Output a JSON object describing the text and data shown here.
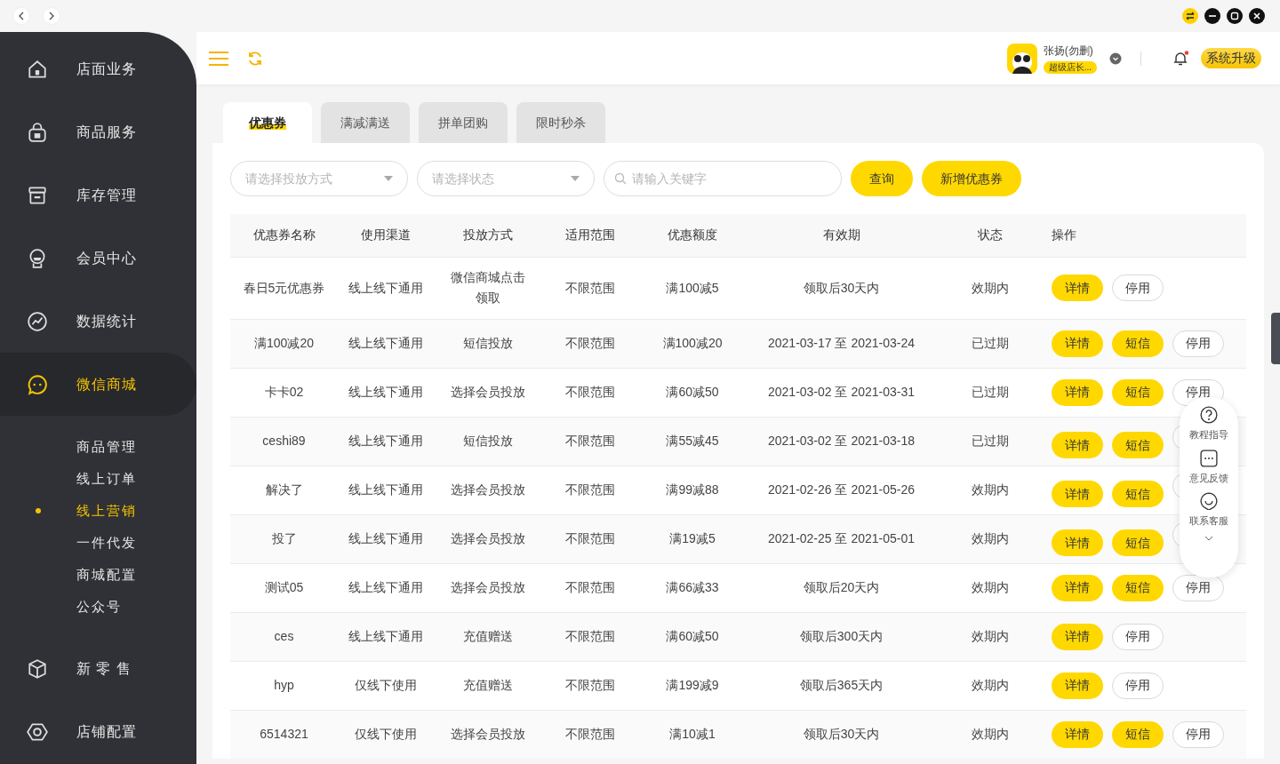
{
  "sidebar": {
    "items": [
      {
        "label": "店面业务",
        "selected": false
      },
      {
        "label": "商品服务",
        "selected": false
      },
      {
        "label": "库存管理",
        "selected": false
      },
      {
        "label": "会员中心",
        "selected": false
      },
      {
        "label": "数据统计",
        "selected": false
      },
      {
        "label": "微信商城",
        "selected": true,
        "children": [
          {
            "label": "商品管理",
            "selected": false
          },
          {
            "label": "线上订单",
            "selected": false
          },
          {
            "label": "线上营销",
            "selected": true
          },
          {
            "label": "一件代发",
            "selected": false
          },
          {
            "label": "商城配置",
            "selected": false
          },
          {
            "label": "公众号",
            "selected": false
          }
        ]
      },
      {
        "label": "新 零 售",
        "selected": false
      },
      {
        "label": "店铺配置",
        "selected": false
      }
    ]
  },
  "header": {
    "user": {
      "name": "张扬(勿删)",
      "role": "超级店长..."
    },
    "notifications": {
      "unread": true
    },
    "upgrade_button": "系统升级"
  },
  "tabs": [
    {
      "label": "优惠券",
      "selected": true
    },
    {
      "label": "满减满送",
      "selected": false
    },
    {
      "label": "拼单团购",
      "selected": false
    },
    {
      "label": "限时秒杀",
      "selected": false
    }
  ],
  "filters": {
    "method": {
      "placeholder": "请选择投放方式"
    },
    "status": {
      "placeholder": "请选择状态"
    },
    "search": {
      "placeholder": "请输入关键字"
    },
    "query_button": "查询",
    "add_button": "新增优惠券"
  },
  "table": {
    "columns": [
      "优惠券名称",
      "使用渠道",
      "投放方式",
      "适用范围",
      "优惠额度",
      "有效期",
      "状态",
      "操作"
    ],
    "rows": [
      {
        "cells": [
          "春日5元优惠券",
          "线上线下通用",
          "微信商城点击领取",
          "不限范围",
          "满100减5",
          "领取后30天内",
          "效期内"
        ],
        "actions": [
          {
            "kind": "primary",
            "label": "详情"
          },
          {
            "kind": "outline",
            "label": "停用"
          }
        ]
      },
      {
        "cells": [
          "满100减20",
          "线上线下通用",
          "短信投放",
          "不限范围",
          "满100减20",
          "2021-03-17 至 2021-03-24",
          "已过期"
        ],
        "actions": [
          {
            "kind": "primary",
            "label": "详情"
          },
          {
            "kind": "primary",
            "label": "短信"
          },
          {
            "kind": "outline",
            "label": "停用"
          }
        ]
      },
      {
        "cells": [
          "卡卡02",
          "线上线下通用",
          "选择会员投放",
          "不限范围",
          "满60减50",
          "2021-03-02 至 2021-03-31",
          "已过期"
        ],
        "actions": [
          {
            "kind": "primary",
            "label": "详情"
          },
          {
            "kind": "primary",
            "label": "短信"
          },
          {
            "kind": "outline",
            "label": "停用"
          }
        ]
      },
      {
        "cells": [
          "ceshi89",
          "线上线下通用",
          "短信投放",
          "不限范围",
          "满55减45",
          "2021-03-02 至 2021-03-18",
          "已过期"
        ],
        "actions": [
          {
            "kind": "primary",
            "label": "详情"
          },
          {
            "kind": "primary",
            "label": "短信"
          },
          {
            "kind": "outline"
          }
        ]
      },
      {
        "cells": [
          "解决了",
          "线上线下通用",
          "选择会员投放",
          "不限范围",
          "满99减88",
          "2021-02-26 至 2021-05-26",
          "效期内"
        ],
        "actions": [
          {
            "kind": "primary",
            "label": "详情"
          },
          {
            "kind": "primary",
            "label": "短信"
          },
          {
            "kind": "outline"
          }
        ]
      },
      {
        "cells": [
          "投了",
          "线上线下通用",
          "选择会员投放",
          "不限范围",
          "满19减5",
          "2021-02-25 至 2021-05-01",
          "效期内"
        ],
        "actions": [
          {
            "kind": "primary",
            "label": "详情"
          },
          {
            "kind": "primary",
            "label": "短信"
          },
          {
            "kind": "outline"
          }
        ]
      },
      {
        "cells": [
          "测试05",
          "线上线下通用",
          "选择会员投放",
          "不限范围",
          "满66减33",
          "领取后20天内",
          "效期内"
        ],
        "actions": [
          {
            "kind": "primary",
            "label": "详情"
          },
          {
            "kind": "primary",
            "label": "短信"
          },
          {
            "kind": "outline",
            "label": "停用"
          }
        ]
      },
      {
        "cells": [
          "ces",
          "线上线下通用",
          "充值赠送",
          "不限范围",
          "满60减50",
          "领取后300天内",
          "效期内"
        ],
        "actions": [
          {
            "kind": "primary",
            "label": "详情"
          },
          {
            "kind": "outline",
            "label": "停用"
          }
        ]
      },
      {
        "cells": [
          "hyp",
          "仅线下使用",
          "充值赠送",
          "不限范围",
          "满199减9",
          "领取后365天内",
          "效期内"
        ],
        "actions": [
          {
            "kind": "primary",
            "label": "详情"
          },
          {
            "kind": "outline",
            "label": "停用"
          }
        ]
      },
      {
        "cells": [
          "6514321",
          "仅线下使用",
          "选择会员投放",
          "不限范围",
          "满10减1",
          "领取后30天内",
          "效期内"
        ],
        "actions": [
          {
            "kind": "primary",
            "label": "详情"
          },
          {
            "kind": "primary",
            "label": "短信"
          },
          {
            "kind": "outline",
            "label": "停用"
          }
        ]
      }
    ]
  },
  "help_panel": {
    "items": [
      {
        "label": "教程指导"
      },
      {
        "label": "意见反馈"
      },
      {
        "label": "联系客服"
      }
    ]
  }
}
